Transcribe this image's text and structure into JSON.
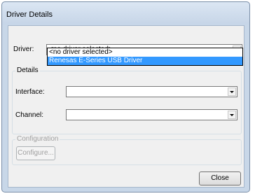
{
  "window": {
    "title": "Driver Details"
  },
  "driver": {
    "label": "Driver:",
    "selected": "<no driver selected>",
    "options": [
      "<no driver selected>",
      "Renesas E-Series USB Driver"
    ],
    "highlighted_index": 1
  },
  "details": {
    "title": "Details",
    "interface_label": "Interface:",
    "interface_value": "",
    "channel_label": "Channel:",
    "channel_value": ""
  },
  "configuration": {
    "title": "Configuration",
    "configure_label": "Configure..."
  },
  "close_label": "Close",
  "colors": {
    "highlight": "#3399ff",
    "frame": "#c8d7e8"
  },
  "icons": {
    "combo_arrow": "chevron-down-icon"
  }
}
